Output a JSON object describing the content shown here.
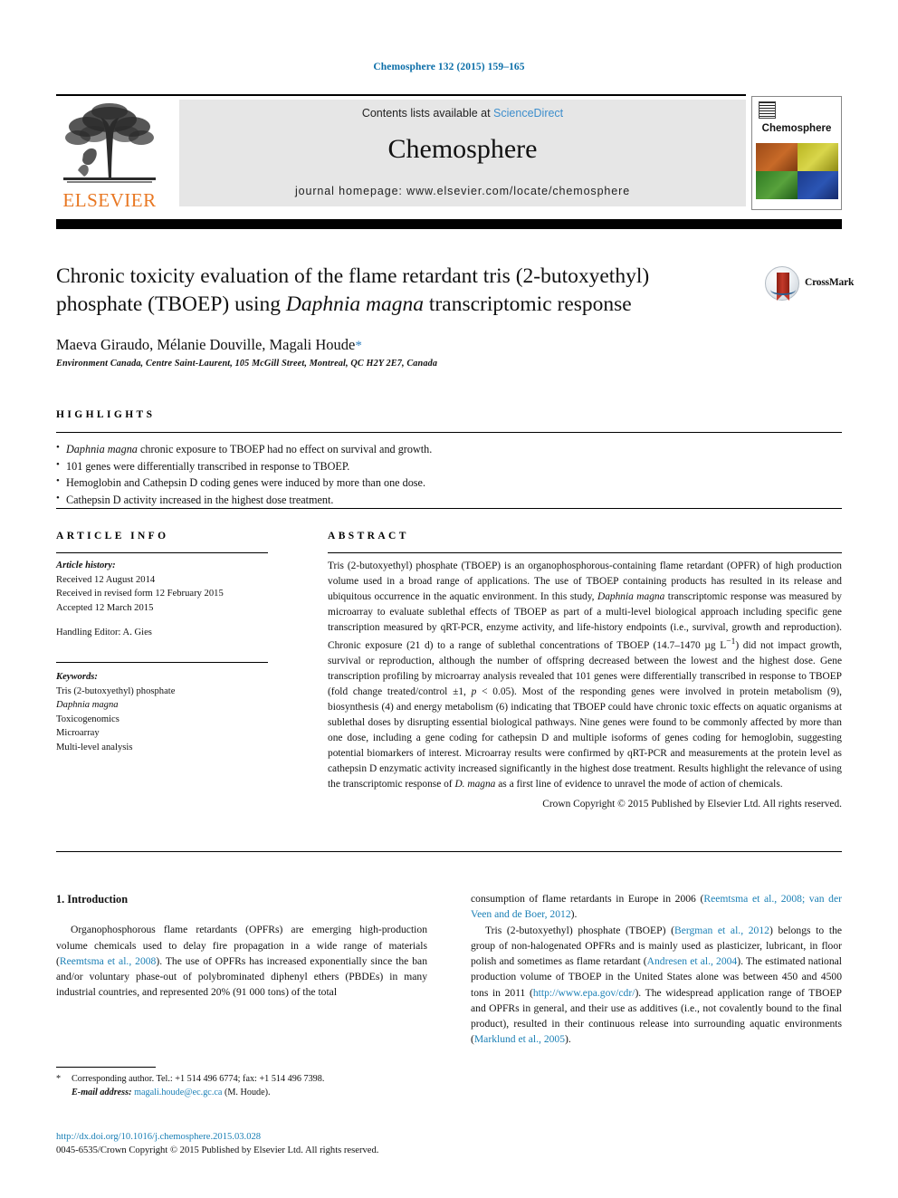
{
  "running_head": "Chemosphere 132 (2015) 159–165",
  "journal_header": {
    "publisher_name": "ELSEVIER",
    "contents_prefix": "Contents lists available at ",
    "sciencedirect_link": "ScienceDirect",
    "journal_title": "Chemosphere",
    "homepage": "journal homepage: www.elsevier.com/locate/chemosphere",
    "cover_title": "Chemosphere"
  },
  "article": {
    "title_line1": "Chronic toxicity evaluation of the flame retardant tris (2-butoxyethyl)",
    "title_line2_pre": "phosphate (TBOEP) using ",
    "title_line2_italic": "Daphnia magna",
    "title_line2_post": " transcriptomic response",
    "authors": "Maeva Giraudo, Mélanie Douville, Magali Houde",
    "corresponding_marker": "*",
    "affiliation": "Environment Canada, Centre Saint-Laurent, 105 McGill Street, Montreal, QC H2Y 2E7, Canada",
    "crossmark_label": "CrossMark"
  },
  "highlights": {
    "heading": "HIGHLIGHTS",
    "items": [
      {
        "italic": "Daphnia magna",
        "rest": " chronic exposure to TBOEP had no effect on survival and growth."
      },
      {
        "italic": "",
        "rest": "101 genes were differentially transcribed in response to TBOEP."
      },
      {
        "italic": "",
        "rest": "Hemoglobin and Cathepsin D coding genes were induced by more than one dose."
      },
      {
        "italic": "",
        "rest": "Cathepsin D activity increased in the highest dose treatment."
      }
    ]
  },
  "article_info": {
    "heading": "ARTICLE INFO",
    "history_label": "Article history:",
    "received": "Received 12 August 2014",
    "revised": "Received in revised form 12 February 2015",
    "accepted": "Accepted 12 March 2015",
    "handling_editor": "Handling Editor: A. Gies",
    "keywords_label": "Keywords:",
    "keywords": [
      "Tris (2-butoxyethyl) phosphate",
      "Daphnia magna",
      "Toxicogenomics",
      "Microarray",
      "Multi-level analysis"
    ],
    "keyword_italic_index": 1
  },
  "abstract": {
    "heading": "ABSTRACT",
    "part1": "Tris (2-butoxyethyl) phosphate (TBOEP) is an organophosphorous-containing flame retardant (OPFR) of high production volume used in a broad range of applications. The use of TBOEP containing products has resulted in its release and ubiquitous occurrence in the aquatic environment. In this study, ",
    "italic1": "Daphnia magna",
    "part2": " transcriptomic response was measured by microarray to evaluate sublethal effects of TBOEP as part of a multi-level biological approach including specific gene transcription measured by qRT-PCR, enzyme activity, and life-history endpoints (i.e., survival, growth and reproduction). Chronic exposure (21 d) to a range of sublethal concentrations of TBOEP (14.7–1470 µg L",
    "sup1": "−1",
    "part3": ") did not impact growth, survival or reproduction, although the number of offspring decreased between the lowest and the highest dose. Gene transcription profiling by microarray analysis revealed that 101 genes were differentially transcribed in response to TBOEP (fold change treated/control ±1, ",
    "italic2": "p",
    "part4": " < 0.05). Most of the responding genes were involved in protein metabolism (9), biosynthesis (4) and energy metabolism (6) indicating that TBOEP could have chronic toxic effects on aquatic organisms at sublethal doses by disrupting essential biological pathways. Nine genes were found to be commonly affected by more than one dose, including a gene coding for cathepsin D and multiple isoforms of genes coding for hemoglobin, suggesting potential biomarkers of interest. Microarray results were confirmed by qRT-PCR and measurements at the protein level as cathepsin D enzymatic activity increased significantly in the highest dose treatment. Results highlight the relevance of using the transcriptomic response of ",
    "italic3": "D. magna",
    "part5": " as a first line of evidence to unravel the mode of action of chemicals.",
    "copyright": "Crown Copyright © 2015 Published by Elsevier Ltd. All rights reserved."
  },
  "body": {
    "section_heading": "1. Introduction",
    "left_paragraph_pre": "Organophosphorous flame retardants (OPFRs) are emerging high-production volume chemicals used to delay fire propagation in a wide range of materials (",
    "left_citation1": "Reemtsma et al., 2008",
    "left_paragraph_post": "). The use of OPFRs has increased exponentially since the ban and/or voluntary phase-out of polybrominated diphenyl ethers (PBDEs) in many industrial countries, and represented 20% (91 000 tons) of the total",
    "right_p1_pre": "consumption of flame retardants in Europe in 2006 (",
    "right_p1_citation": "Reemtsma et al., 2008; van der Veen and de Boer, 2012",
    "right_p1_post": ").",
    "right_p2_a": "Tris (2-butoxyethyl) phosphate (TBOEP) (",
    "right_p2_cit1": "Bergman et al., 2012",
    "right_p2_b": ") belongs to the group of non-halogenated OPFRs and is mainly used as plasticizer, lubricant, in floor polish and sometimes as flame retardant (",
    "right_p2_cit2": "Andresen et al., 2004",
    "right_p2_c": "). The estimated national production volume of TBOEP in the United States alone was between 450 and 4500 tons in 2011 (",
    "right_p2_cit3": "http://www.epa.gov/cdr/",
    "right_p2_d": "). The widespread application range of TBOEP and OPFRs in general, and their use as additives (i.e., not covalently bound to the final product), resulted in their continuous release into surrounding aquatic environments (",
    "right_p2_cit4": "Marklund et al., 2005",
    "right_p2_e": ")."
  },
  "footnote": {
    "marker": "*",
    "text": "Corresponding author. Tel.: +1 514 496 6774; fax: +1 514 496 7398.",
    "email_label": "E-mail address:",
    "email": "magali.houde@ec.gc.ca",
    "email_suffix": " (M. Houde)."
  },
  "footer": {
    "doi": "http://dx.doi.org/10.1016/j.chemosphere.2015.03.028",
    "issn_line": "0045-6535/Crown Copyright © 2015 Published by Elsevier Ltd. All rights reserved."
  },
  "colors": {
    "link_blue": "#1a7fb5",
    "header_blue": "#0b6ea8",
    "sciencedirect_blue": "#3d8ecc",
    "elsevier_orange": "#e87722"
  }
}
